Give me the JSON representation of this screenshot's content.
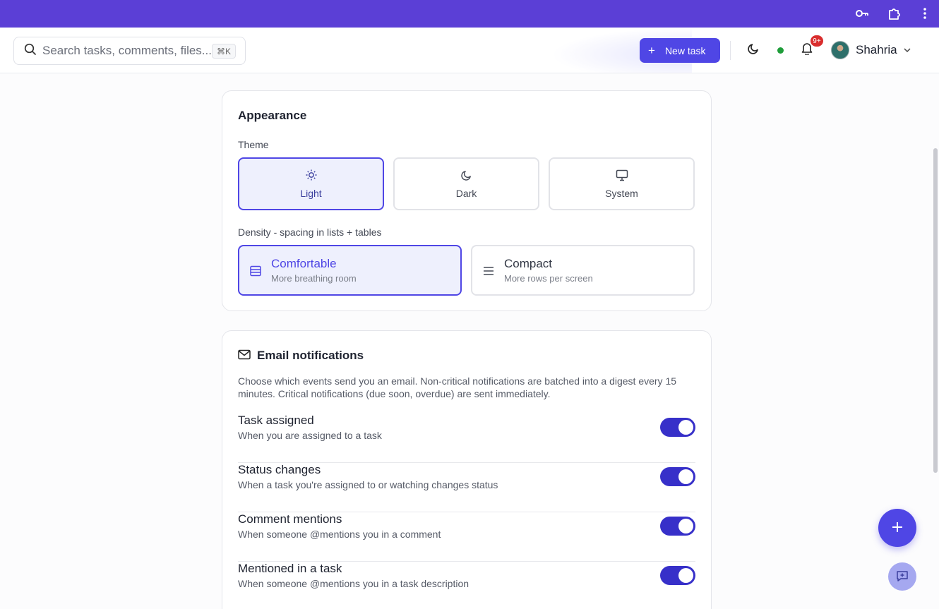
{
  "colors": {
    "chrome": "#5b3fd6",
    "accent": "#4f46e5",
    "status_online": "#1f9d3a",
    "badge": "#d92d2d",
    "toggle_on": "#3730c9"
  },
  "chrome": {
    "icons": [
      "key-icon",
      "puzzle-extension-icon",
      "kebab-menu-icon"
    ]
  },
  "header": {
    "search_placeholder": "Search tasks, comments, files...",
    "search_shortcut": "⌘K",
    "new_task_label": "New task",
    "notification_count": "9+",
    "user_name": "Shahria"
  },
  "appearance": {
    "title": "Appearance",
    "theme_label": "Theme",
    "themes": [
      {
        "label": "Light",
        "icon": "sun-icon",
        "selected": true
      },
      {
        "label": "Dark",
        "icon": "moon-icon",
        "selected": false
      },
      {
        "label": "System",
        "icon": "monitor-icon",
        "selected": false
      }
    ],
    "density_label": "Density - spacing in lists + tables",
    "densities": [
      {
        "label": "Comfortable",
        "sub": "More breathing room",
        "icon": "rows-icon",
        "selected": true
      },
      {
        "label": "Compact",
        "sub": "More rows per screen",
        "icon": "menu-lines-icon",
        "selected": false
      }
    ]
  },
  "email": {
    "title": "Email notifications",
    "description": "Choose which events send you an email. Non-critical notifications are batched into a digest every 15 minutes. Critical notifications (due soon, overdue) are sent immediately.",
    "items": [
      {
        "title": "Task assigned",
        "desc": "When you are assigned to a task",
        "enabled": true
      },
      {
        "title": "Status changes",
        "desc": "When a task you're assigned to or watching changes status",
        "enabled": true
      },
      {
        "title": "Comment mentions",
        "desc": "When someone @mentions you in a comment",
        "enabled": true
      },
      {
        "title": "Mentioned in a task",
        "desc": "When someone @mentions you in a task description",
        "enabled": true
      }
    ]
  }
}
